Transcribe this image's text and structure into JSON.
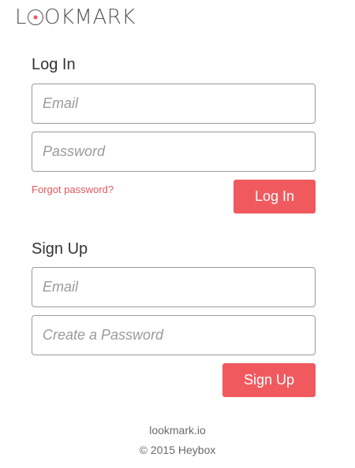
{
  "brand": {
    "logo_prefix": "L",
    "logo_suffix": "OKMARK",
    "accent_color": "#f05a5e"
  },
  "login": {
    "title": "Log In",
    "email_placeholder": "Email",
    "password_placeholder": "Password",
    "forgot_label": "Forgot password?",
    "submit_label": "Log In"
  },
  "signup": {
    "title": "Sign Up",
    "email_placeholder": "Email",
    "password_placeholder": "Create a Password",
    "submit_label": "Sign Up"
  },
  "footer": {
    "site": "lookmark.io",
    "copyright": "© 2015 Heybox"
  }
}
